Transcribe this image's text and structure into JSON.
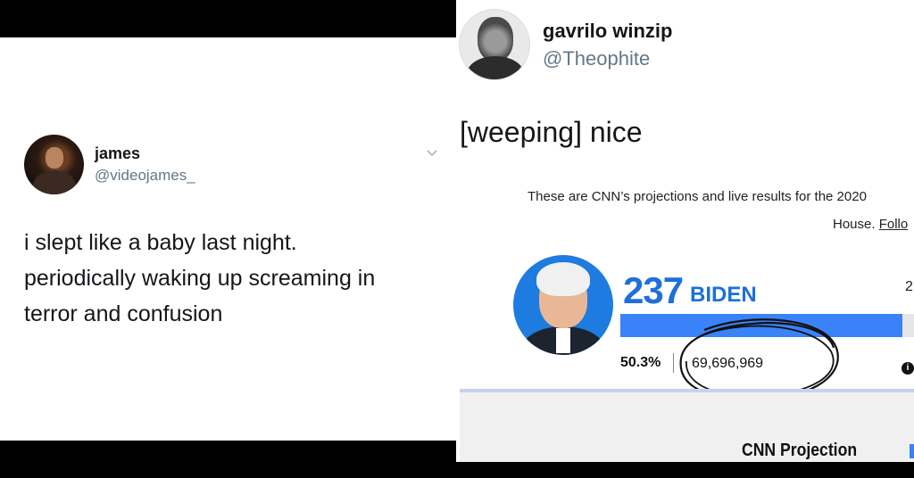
{
  "left_tweet": {
    "name": "james",
    "handle": "@videojames_",
    "lines": [
      "i slept like a baby last night.",
      "periodically waking up screaming in",
      "terror and confusion"
    ]
  },
  "right_tweet": {
    "name": "gavrilo winzip",
    "handle": "@Theophite",
    "text": "[weeping] nice",
    "cnn_card": {
      "intro_line1": "These are CNN’s projections and live results for the 2020",
      "intro_line2": "House.",
      "intro_link": "Follo",
      "candidate": {
        "electoral_votes": "237",
        "name": "BIDEN",
        "percent": "50.3%",
        "votes": "69,696,969",
        "progress_fraction": 0.93
      },
      "right_cut_value": "2",
      "footer_label": "CNN Projection"
    }
  }
}
